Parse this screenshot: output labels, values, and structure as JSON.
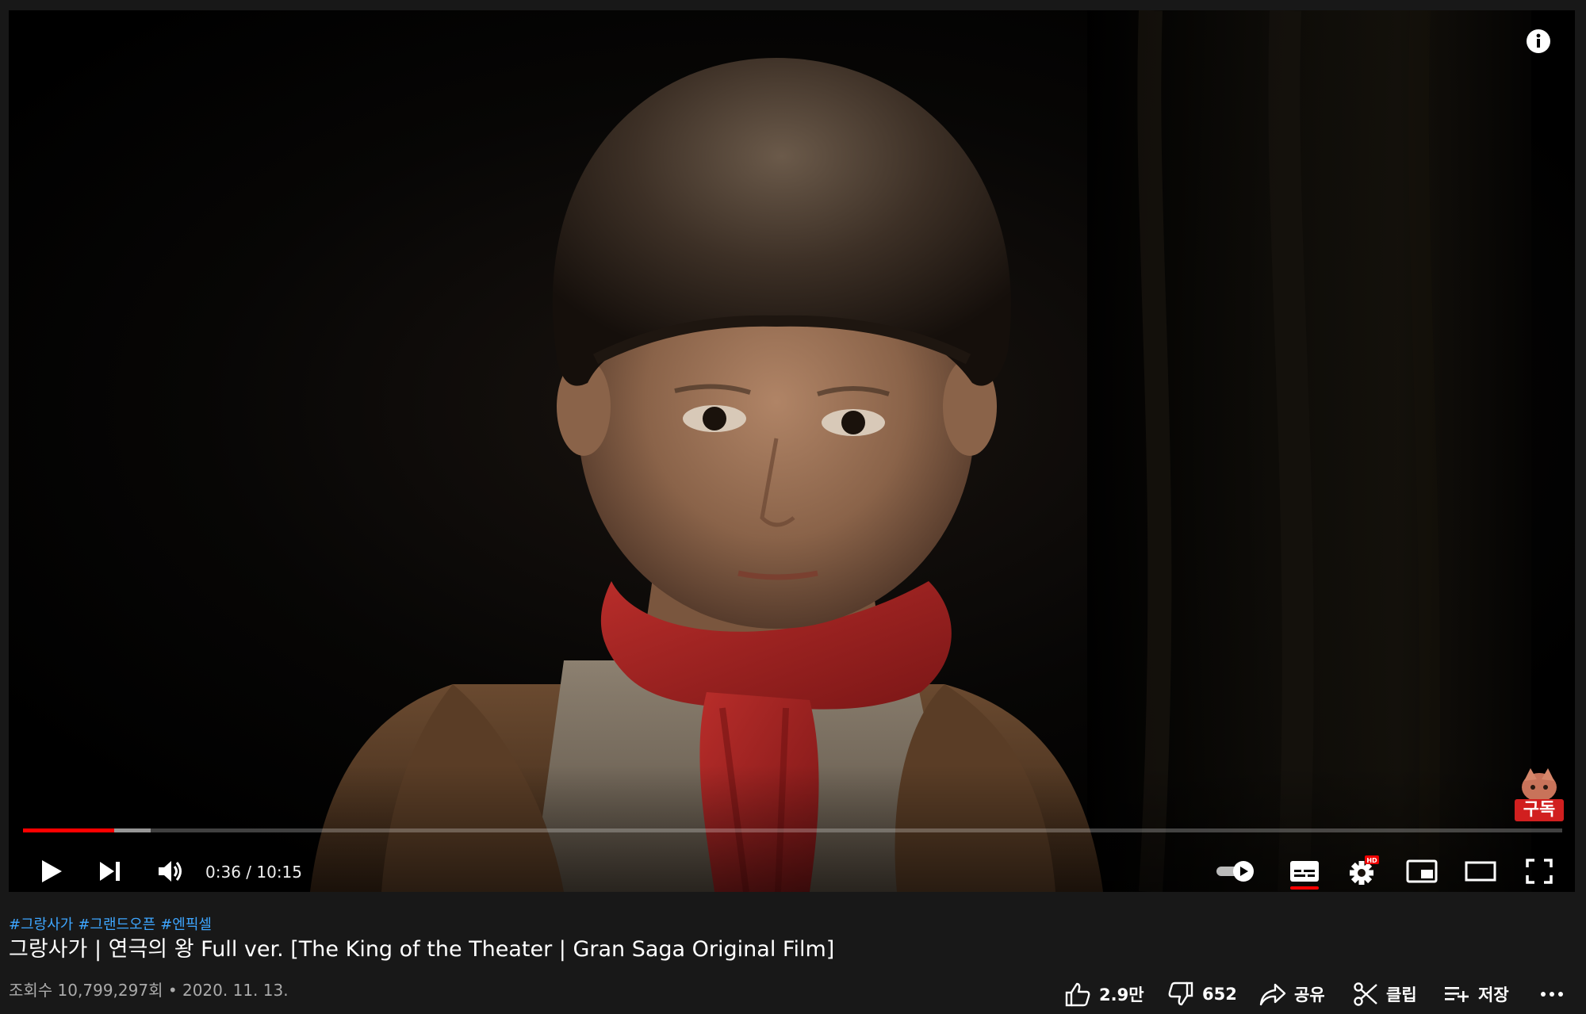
{
  "player": {
    "current_time": "0:36",
    "duration": "10:15",
    "time_display": "0:36 / 10:15",
    "progress_played_fraction": 0.059,
    "progress_buffered_fraction": 0.083,
    "settings_badge": "HD",
    "watermark_text": "구독",
    "colors": {
      "progress_played": "#ff0000",
      "scarf": "#a42424",
      "background": "#000000"
    },
    "icons": [
      "info-icon",
      "play-icon",
      "next-icon",
      "volume-icon",
      "autoplay-toggle-icon",
      "subtitles-icon",
      "settings-icon",
      "miniplayer-icon",
      "theater-mode-icon",
      "fullscreen-icon"
    ]
  },
  "video": {
    "hashtags": [
      "#그랑사가",
      "#그랜드오픈",
      "#엔픽셀"
    ],
    "title": "그랑사가 | 연극의 왕 Full ver. [The King of the Theater | Gran Saga Original Film]",
    "view_info": "조회수 10,799,297회 • 2020. 11. 13."
  },
  "actions": {
    "like_count": "2.9만",
    "dislike_count": "652",
    "share_label": "공유",
    "clip_label": "클립",
    "save_label": "저장",
    "more_icon": "more-horizontal-icon"
  }
}
